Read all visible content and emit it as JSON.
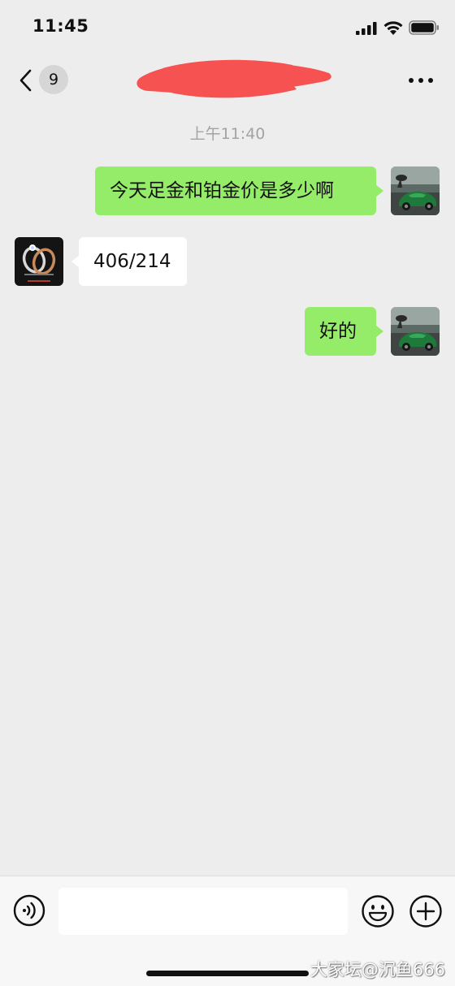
{
  "status_bar": {
    "time": "11:45"
  },
  "nav": {
    "unread_count": "9",
    "back_icon": "chevron-left-icon",
    "more_icon": "more-dots-icon",
    "title_redaction_color": "#f65252"
  },
  "chat": {
    "timestamp": "上午11:40",
    "messages": [
      {
        "direction": "outgoing",
        "text": "今天足金和铂金价是多少啊"
      },
      {
        "direction": "incoming",
        "text": "406/214"
      },
      {
        "direction": "outgoing",
        "text": "好的"
      }
    ]
  },
  "input_bar": {
    "voice_icon": "voice-icon",
    "emoji_icon": "emoji-icon",
    "plus_icon": "plus-icon",
    "input_value": ""
  },
  "watermark": "大家坛@沉鱼666",
  "colors": {
    "background": "#ededed",
    "outgoing_bubble": "#95ec69",
    "incoming_bubble": "#ffffff",
    "timestamp_text": "#a3a3a3",
    "input_bar_bg": "#f7f7f7"
  }
}
